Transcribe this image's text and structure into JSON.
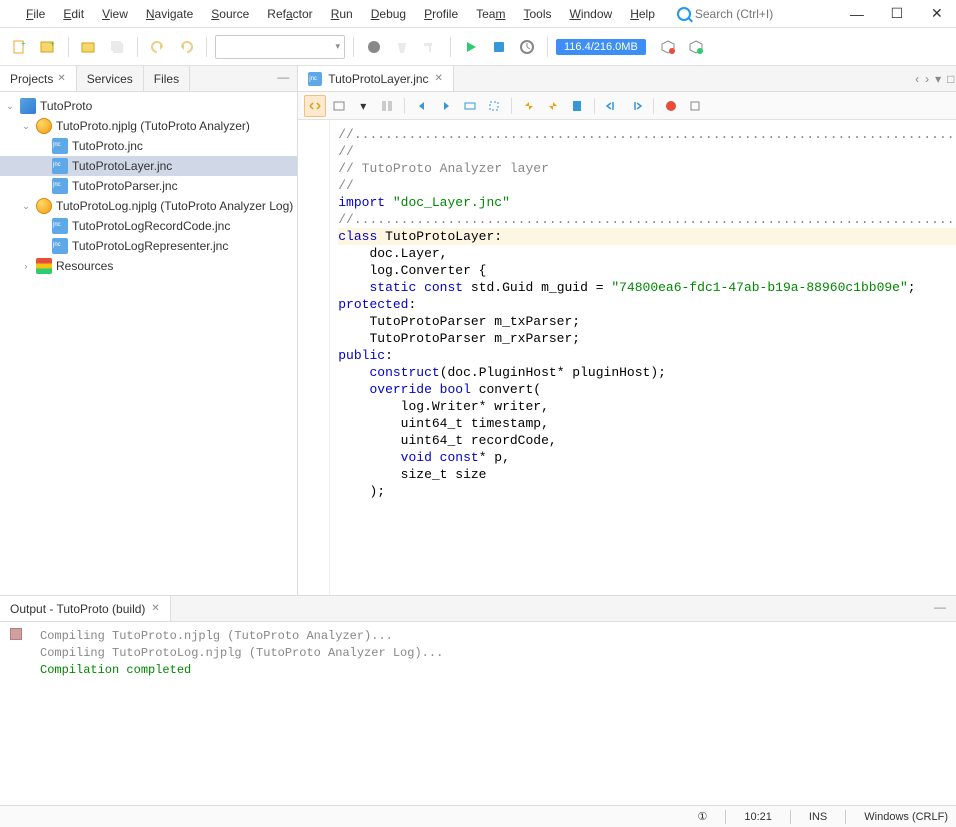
{
  "menu": {
    "file": "File",
    "edit": "Edit",
    "view": "View",
    "navigate": "Navigate",
    "source": "Source",
    "refactor": "Refactor",
    "run": "Run",
    "debug": "Debug",
    "profile": "Profile",
    "team": "Team",
    "tools": "Tools",
    "window": "Window",
    "help": "Help"
  },
  "search": {
    "placeholder": "Search (Ctrl+I)"
  },
  "memory": "116.4/216.0MB",
  "panels": {
    "projects": "Projects",
    "services": "Services",
    "files": "Files"
  },
  "tree": {
    "root": "TutoProto",
    "pkg1": "TutoProto.njplg (TutoProto Analyzer)",
    "f1": "TutoProto.jnc",
    "f2": "TutoProtoLayer.jnc",
    "f3": "TutoProtoParser.jnc",
    "pkg2": "TutoProtoLog.njplg (TutoProto Analyzer Log)",
    "f4": "TutoProtoLogRecordCode.jnc",
    "f5": "TutoProtoLogRepresenter.jnc",
    "res": "Resources"
  },
  "editor": {
    "tab": "TutoProtoLayer.jnc",
    "lines": [
      {
        "t": "//..............................................................................",
        "cls": "c-comment"
      },
      {
        "t": "//",
        "cls": "c-comment"
      },
      {
        "t": "// TutoProto Analyzer layer",
        "cls": "c-comment"
      },
      {
        "t": "//",
        "cls": "c-comment"
      },
      {
        "t": "",
        "cls": ""
      },
      {
        "segs": [
          {
            "t": "import ",
            "cls": "c-keyword"
          },
          {
            "t": "\"doc_Layer.jnc\"",
            "cls": "c-string"
          }
        ]
      },
      {
        "t": "",
        "cls": ""
      },
      {
        "t": "//..............................................................................",
        "cls": "c-comment"
      },
      {
        "t": "",
        "cls": ""
      },
      {
        "hl": true,
        "segs": [
          {
            "t": "class ",
            "cls": "c-keyword"
          },
          {
            "t": "TutoProtoLayer:",
            "cls": "c-ident"
          }
        ]
      },
      {
        "t": "    doc.Layer,",
        "cls": "c-ident"
      },
      {
        "t": "    log.Converter {",
        "cls": "c-ident"
      },
      {
        "segs": [
          {
            "t": "    "
          },
          {
            "t": "static const",
            "cls": "c-keyword"
          },
          {
            "t": " std.Guid m_guid = ",
            "cls": "c-ident"
          },
          {
            "t": "\"74800ea6-fdc1-47ab-b19a-88960c1bb09e\"",
            "cls": "c-string"
          },
          {
            "t": ";",
            "cls": "c-ident"
          }
        ]
      },
      {
        "t": "",
        "cls": ""
      },
      {
        "segs": [
          {
            "t": "protected",
            "cls": "c-keyword"
          },
          {
            "t": ":",
            "cls": "c-ident"
          }
        ]
      },
      {
        "t": "    TutoProtoParser m_txParser;",
        "cls": "c-ident"
      },
      {
        "t": "    TutoProtoParser m_rxParser;",
        "cls": "c-ident"
      },
      {
        "t": "",
        "cls": ""
      },
      {
        "segs": [
          {
            "t": "public",
            "cls": "c-keyword"
          },
          {
            "t": ":",
            "cls": "c-ident"
          }
        ]
      },
      {
        "segs": [
          {
            "t": "    "
          },
          {
            "t": "construct",
            "cls": "c-type"
          },
          {
            "t": "(doc.PluginHost* pluginHost);",
            "cls": "c-ident"
          }
        ]
      },
      {
        "t": "",
        "cls": ""
      },
      {
        "segs": [
          {
            "t": "    "
          },
          {
            "t": "override bool",
            "cls": "c-keyword"
          },
          {
            "t": " convert(",
            "cls": "c-ident"
          }
        ]
      },
      {
        "t": "        log.Writer* writer,",
        "cls": "c-ident"
      },
      {
        "t": "        uint64_t timestamp,",
        "cls": "c-ident"
      },
      {
        "t": "        uint64_t recordCode,",
        "cls": "c-ident"
      },
      {
        "segs": [
          {
            "t": "        "
          },
          {
            "t": "void const",
            "cls": "c-keyword"
          },
          {
            "t": "* p,",
            "cls": "c-ident"
          }
        ]
      },
      {
        "t": "        size_t size",
        "cls": "c-ident"
      },
      {
        "t": "    );",
        "cls": "c-ident"
      }
    ]
  },
  "output": {
    "title": "Output - TutoProto (build)",
    "lines": [
      {
        "t": "Compiling TutoProto.njplg (TutoProto Analyzer)...",
        "cls": ""
      },
      {
        "t": "Compiling TutoProtoLog.njplg (TutoProto Analyzer Log)...",
        "cls": ""
      },
      {
        "t": "Compilation completed",
        "cls": "out-success"
      }
    ]
  },
  "status": {
    "pos": "10:21",
    "ins": "INS",
    "eol": "Windows (CRLF)"
  }
}
